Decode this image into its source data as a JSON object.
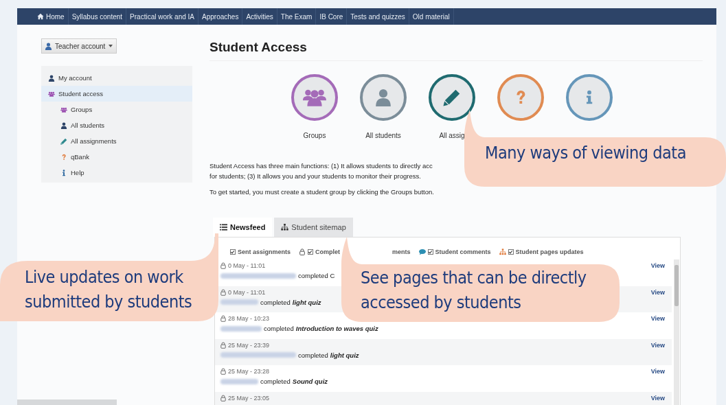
{
  "nav": {
    "items": [
      {
        "label": "Home",
        "kind": "home"
      },
      {
        "label": "Syllabus content",
        "kind": "plain"
      },
      {
        "label": "Practical work and IA",
        "kind": "plain"
      },
      {
        "label": "Approaches",
        "kind": "plain"
      },
      {
        "label": "Activities",
        "kind": "plain"
      },
      {
        "label": "The Exam",
        "kind": "plain"
      },
      {
        "label": "IB Core",
        "kind": "plain"
      },
      {
        "label": "Tests and quizzes",
        "kind": "plain"
      },
      {
        "label": "Old material",
        "kind": "plain"
      }
    ]
  },
  "account_button": {
    "label": "Teacher account"
  },
  "sidebar": {
    "items": [
      {
        "label": "My account",
        "kind": "person",
        "selected": false
      },
      {
        "label": "Student access",
        "kind": "group",
        "selected": true,
        "children": [
          {
            "label": "Groups",
            "kind": "group",
            "selected": false
          },
          {
            "label": "All students",
            "kind": "person",
            "selected": false
          },
          {
            "label": "All assignments",
            "kind": "pencil",
            "selected": false
          },
          {
            "label": "qBank",
            "kind": "question",
            "selected": false
          },
          {
            "label": "Help",
            "kind": "info",
            "selected": false
          }
        ]
      }
    ]
  },
  "page_title": "Student Access",
  "shortcuts": [
    {
      "kind": "group",
      "color": "#a46bb8",
      "label": "Groups"
    },
    {
      "kind": "person",
      "color": "#7b8d99",
      "label": "All students"
    },
    {
      "kind": "pencil",
      "color": "#1f6b70",
      "label": "All assig"
    },
    {
      "kind": "question",
      "color": "#e08b52"
    },
    {
      "kind": "info",
      "color": "#6596b9"
    }
  ],
  "intro": [
    "Student Access has three main functions: (1) It allows students to directly acc",
    "for students; (3) It allows you and your students to monitor their progress.",
    "To get started, you must create a student group by clicking the Groups button."
  ],
  "tabs": [
    {
      "label": "Newsfeed",
      "kind": "list",
      "selected": true
    },
    {
      "label": "Student sitemap",
      "kind": "sitemap",
      "selected": false
    }
  ],
  "filters": [
    {
      "label": "Sent assignments",
      "kind": "plain",
      "checked": true
    },
    {
      "label": "Complet",
      "label_end": "ments",
      "kind": "lock",
      "checked": true
    },
    {
      "label": "Student comments",
      "kind": "comment",
      "checked": true
    },
    {
      "label": "Student pages updates",
      "kind": "sitemap",
      "checked": true
    }
  ],
  "feed": [
    {
      "date": "0 May - 11:01",
      "action": "completed C",
      "link": "View"
    },
    {
      "date": "0 May - 11:01",
      "action": "completed",
      "item": "light quiz",
      "link": "View"
    },
    {
      "date": "28 May - 10:23",
      "action": "completed",
      "item": "Introduction to waves quiz",
      "link": "View"
    },
    {
      "date": "25 May - 23:39",
      "action": "completed",
      "item": "light quiz",
      "link": "View"
    },
    {
      "date": "25 May - 23:28",
      "action": "completed",
      "item": "Sound quiz",
      "link": "View"
    },
    {
      "date": "25 May - 23:05",
      "link": "View"
    }
  ],
  "callouts": [
    {
      "kind": "tail-left-top",
      "text": "Many ways of viewing data"
    },
    {
      "kind": "tail-right-top",
      "text": "Live updates on work submitted by students"
    },
    {
      "kind": "tail-left-top",
      "text": "See pages that can be directly accessed by students"
    }
  ]
}
